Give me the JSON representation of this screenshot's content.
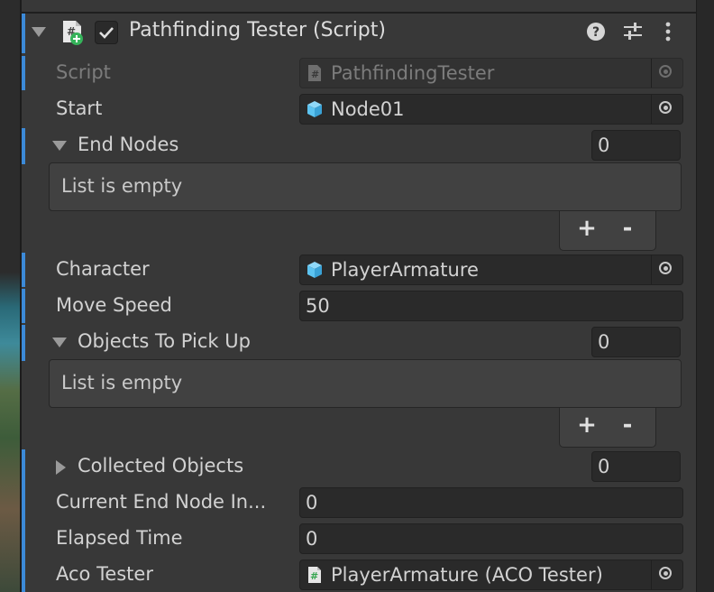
{
  "component": {
    "title": "Pathfinding Tester (Script)",
    "enabled": true,
    "help_icon": "help-icon",
    "presets_icon": "sliders-icon",
    "menu_icon": "kebab-menu-icon"
  },
  "fields": {
    "script": {
      "label": "Script",
      "value": "PathfindingTester",
      "icon": "script-hash-icon"
    },
    "start": {
      "label": "Start",
      "value": "Node01",
      "icon": "gameobject-cube-icon"
    },
    "end_nodes": {
      "label": "End Nodes",
      "count": "0",
      "empty_text": "List is empty",
      "add": "+",
      "remove": "-"
    },
    "character": {
      "label": "Character",
      "value": "PlayerArmature",
      "icon": "gameobject-cube-icon"
    },
    "move_speed": {
      "label": "Move Speed",
      "value": "50"
    },
    "objects_to_pick_up": {
      "label": "Objects To Pick Up",
      "count": "0",
      "empty_text": "List is empty",
      "add": "+",
      "remove": "-"
    },
    "collected_objects": {
      "label": "Collected Objects",
      "count": "0"
    },
    "current_end_node_index": {
      "label": "Current End Node In...",
      "value": "0"
    },
    "elapsed_time": {
      "label": "Elapsed Time",
      "value": "0"
    },
    "aco_tester": {
      "label": "Aco Tester",
      "value": "PlayerArmature (ACO Tester)",
      "icon": "script-hash-icon"
    }
  },
  "colors": {
    "background": "#383838",
    "field": "#2a2a2a",
    "accent_bar": "#3c8ad8",
    "cube_icon": "#5cc3f0",
    "script_icon_add": "#35b35a"
  }
}
